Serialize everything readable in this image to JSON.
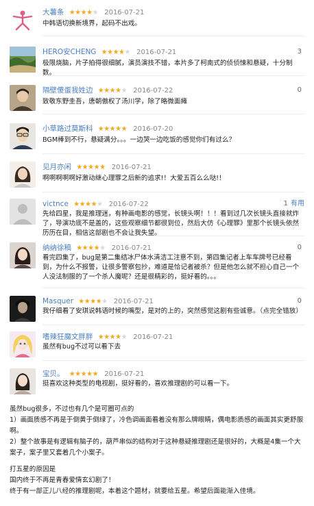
{
  "colors": {
    "username": "#4a7fc1",
    "star_on": "#f5a623",
    "star_off": "#d8d8d8",
    "date": "#888888"
  },
  "reviews": [
    {
      "user": "大薯条",
      "rating": 4,
      "date": "2016-07-21",
      "count": "",
      "useful": "",
      "avatar": "pink-dancer-avatar",
      "text": "中韩语切换新境界，起码不出戏。"
    },
    {
      "user": "HERO安CHENG",
      "rating": 4,
      "date": "2016-07-21",
      "count": "3",
      "useful": "",
      "avatar": "scenery-avatar",
      "text": "极限烧脑，片子拍得很细腻，演员演技不错，本片多了柯南式的侦侦悚和悬疑，十分制数。"
    },
    {
      "user": "隔壁傻蛋我姓边",
      "rating": 4,
      "date": "2016-07-22",
      "count": "0",
      "useful": "",
      "avatar": "portrait-avatar",
      "text": "致敬东野圭吾，唐朝傲权了汤川学，除了略微面瘫"
    },
    {
      "user": "小草路过莫斯科",
      "rating": 5,
      "date": "2016-07-20",
      "count": "",
      "useful": "",
      "avatar": "man-glasses-avatar",
      "text": "BGM棒到不行，悬疑满分。。。一边哭一边吃饭的感觉你们有过么？"
    },
    {
      "user": "见月亦闲",
      "rating": 5,
      "date": "2016-07-21",
      "count": "",
      "useful": "",
      "avatar": "woman-avatar",
      "text": "啊啊啊啊啊好激动继心理罪之后新的追求!！大爱五百么么哒!！"
    },
    {
      "user": "victnce",
      "rating": 4,
      "date": "2016-07-22",
      "count": "1",
      "useful": "有用",
      "avatar": "default-avatar",
      "text": "先给四星，我是推理迷，有种画电影的感觉，长镜头啊！！！看到过几次长镜头直接就炸了，导演功底不是盖的，这些观察细节都很到位，然后大仿《心理罪》里那个长镜头依然历历在目，相信这部剧也不会让我失望。"
    },
    {
      "user": "纳纳徐稿",
      "rating": 4,
      "date": "2016-07-21",
      "count": "0",
      "useful": "",
      "avatar": "girl-avatar",
      "text": "看完四集了，bug是第二集结冰尸体水清洁工注意不到，第四集记者上车车牌号已经看到，为什么不报警，让很多警察包抄，难道是恰记者被杀？但是他怎么就不担心自己一个人没法制服的了一个杀人魔呢？还是很精彩的，挺好看的。。。"
    },
    {
      "user": "Masquer",
      "rating": 4,
      "date": "2016-07-21",
      "count": "0",
      "useful": "",
      "avatar": "dark-avatar",
      "text": "我仔细看了安琪说韩语时候的嘴型，是对的上的，突然感觉这剧有些诚意。（点完全错放）"
    },
    {
      "user": "嗜辣狂魔文胖胖",
      "rating": 4,
      "date": "2016-07-21",
      "count": "",
      "useful": "",
      "avatar": "anime-avatar",
      "text": "虽然有bug不过可以看下去"
    },
    {
      "user": "宝贝。",
      "rating": 5,
      "date": "2016-07-21",
      "count": "",
      "useful": "",
      "avatar": "photo-avatar",
      "text": "挺喜欢这种类型的电视剧，挺好看的，喜欢推理剧的可以看一下。"
    }
  ],
  "summary": {
    "p1": "虽然bug很多，不过也有几个是可圈可点的",
    "p2": "1）画面质感不再是于倒黄于倒绿了，冷色调画面看着没有那么牌眼睛，偶电影质感的画面其实更舒服啊。",
    "p3": "2）整个故事是有逻辑有脑子的，葫芦串似的结构对于这种悬疑推理剧还是很好的，大概是4集一个大案子，案子里又套着几个小案子。",
    "p4": "打五星的原因是",
    "p5": "国内终于不再是青春爱情玄幻剧了！",
    "p6": "终于有一部正儿八经的推理剧呢，本着这个题材，就要给五星。希望后面能渐入佳境。"
  }
}
